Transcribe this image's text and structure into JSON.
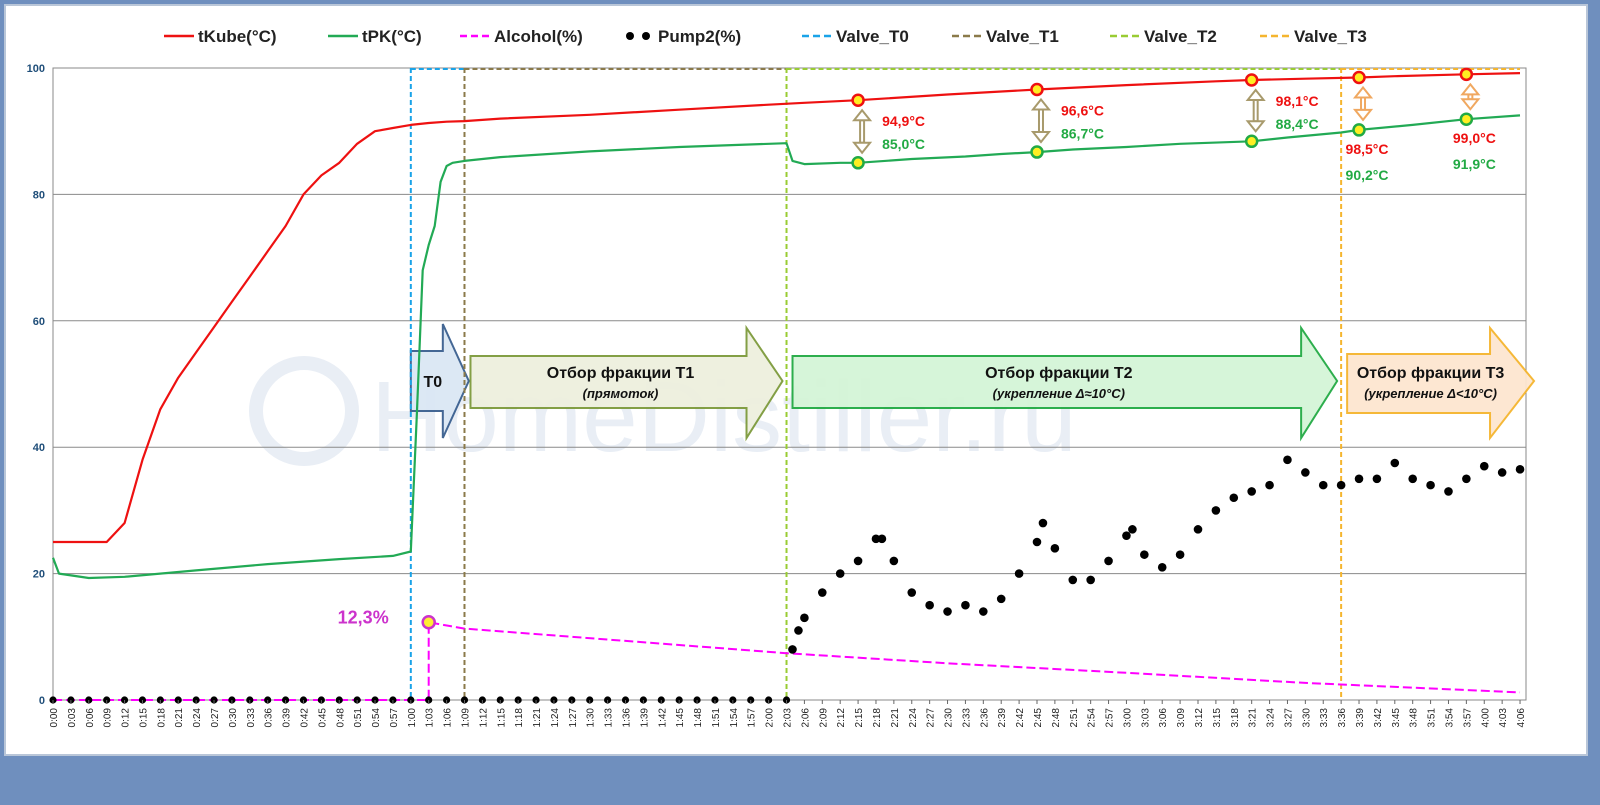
{
  "chart_data": {
    "type": "line",
    "ylim": [
      0,
      100
    ],
    "yticks": [
      0,
      20,
      40,
      60,
      80,
      100
    ],
    "x_start_min": 0,
    "x_end_min": 247,
    "x_tick_step_min": 3,
    "xtick_labels": [
      "0:00",
      "0:03",
      "0:06",
      "0:09",
      "0:12",
      "0:15",
      "0:18",
      "0:21",
      "0:24",
      "0:27",
      "0:30",
      "0:33",
      "0:36",
      "0:39",
      "0:42",
      "0:45",
      "0:48",
      "0:51",
      "0:54",
      "0:57",
      "1:00",
      "1:03",
      "1:06",
      "1:09",
      "1:12",
      "1:15",
      "1:18",
      "1:21",
      "1:24",
      "1:27",
      "1:30",
      "1:33",
      "1:36",
      "1:39",
      "1:42",
      "1:45",
      "1:48",
      "1:51",
      "1:54",
      "1:57",
      "2:00",
      "2:03",
      "2:06",
      "2:09",
      "2:12",
      "2:15",
      "2:18",
      "2:21",
      "2:24",
      "2:27",
      "2:30",
      "2:33",
      "2:36",
      "2:39",
      "2:42",
      "2:45",
      "2:48",
      "2:51",
      "2:54",
      "2:57",
      "3:00",
      "3:03",
      "3:06",
      "3:09",
      "3:12",
      "3:15",
      "3:18",
      "3:21",
      "3:24",
      "3:27",
      "3:30",
      "3:33",
      "3:36",
      "3:39",
      "3:42",
      "3:45",
      "3:48",
      "3:51",
      "3:54",
      "3:57",
      "4:00",
      "4:03",
      "4:06"
    ],
    "series": [
      {
        "name": "tKube(°C)",
        "color": "#ee1111",
        "style": "solid",
        "x": [
          "0:00",
          "0:09",
          "0:12",
          "0:15",
          "0:18",
          "0:21",
          "0:24",
          "0:27",
          "0:30",
          "0:33",
          "0:36",
          "0:39",
          "0:42",
          "0:45",
          "0:48",
          "0:51",
          "0:54",
          "0:57",
          "1:00",
          "1:03",
          "1:06",
          "1:09",
          "1:15",
          "1:30",
          "1:45",
          "2:00",
          "2:06",
          "2:15",
          "2:30",
          "2:45",
          "3:00",
          "3:15",
          "3:21",
          "3:30",
          "3:39",
          "3:45",
          "3:57",
          "4:06"
        ],
        "y": [
          25,
          25,
          28,
          38,
          46,
          51,
          55,
          59,
          63,
          67,
          71,
          75,
          80,
          83,
          85,
          88,
          90,
          90.5,
          91,
          91.3,
          91.5,
          91.6,
          92,
          92.6,
          93.4,
          94.2,
          94.5,
          94.9,
          95.8,
          96.6,
          97.3,
          97.9,
          98.1,
          98.3,
          98.5,
          98.7,
          99.0,
          99.2
        ]
      },
      {
        "name": "tPK(°C)",
        "color": "#22aa55",
        "style": "solid",
        "x": [
          "0:00",
          "0:01",
          "0:06",
          "0:12",
          "0:24",
          "0:36",
          "0:48",
          "0:57",
          "1:00",
          "1:01",
          "1:02",
          "1:03",
          "1:04",
          "1:05",
          "1:06",
          "1:07",
          "1:09",
          "1:15",
          "1:30",
          "1:45",
          "2:03",
          "2:04",
          "2:06",
          "2:12",
          "2:15",
          "2:24",
          "2:33",
          "2:39",
          "2:45",
          "2:51",
          "3:00",
          "3:09",
          "3:21",
          "3:27",
          "3:36",
          "3:39",
          "3:48",
          "3:57",
          "4:06"
        ],
        "y": [
          22.5,
          20,
          19.3,
          19.5,
          20.5,
          21.5,
          22.3,
          22.8,
          23.5,
          45,
          68,
          72,
          75,
          82,
          84.5,
          85,
          85.3,
          85.9,
          86.8,
          87.5,
          88.1,
          85.3,
          84.8,
          85,
          85,
          85.6,
          86,
          86.4,
          86.7,
          87.1,
          87.5,
          88,
          88.4,
          89,
          89.8,
          90.2,
          91,
          91.9,
          92.5
        ]
      },
      {
        "name": "Alcohol(%)",
        "color": "#ff00ff",
        "style": "dashed",
        "x": [
          "0:00",
          "1:02",
          "1:03",
          "1:03",
          "1:09",
          "2:03",
          "2:30",
          "3:00",
          "3:30",
          "4:06"
        ],
        "y": [
          0,
          0,
          0,
          12.3,
          11.3,
          7.4,
          5.8,
          4.3,
          2.7,
          1.2
        ]
      },
      {
        "name": "Pump2(%)",
        "color": "#000000",
        "style": "dotted-markers",
        "x": [
          "0:00",
          "2:03",
          "2:04",
          "2:05",
          "2:06",
          "2:09",
          "2:12",
          "2:15",
          "2:18",
          "2:19",
          "2:21",
          "2:24",
          "2:27",
          "2:30",
          "2:33",
          "2:36",
          "2:39",
          "2:42",
          "2:45",
          "2:46",
          "2:48",
          "2:51",
          "2:54",
          "2:57",
          "3:00",
          "3:01",
          "3:03",
          "3:06",
          "3:09",
          "3:12",
          "3:15",
          "3:18",
          "3:21",
          "3:24",
          "3:27",
          "3:30",
          "3:33",
          "3:36",
          "3:39",
          "3:42",
          "3:45",
          "3:48",
          "3:51",
          "3:54",
          "3:57",
          "4:00",
          "4:03",
          "4:06"
        ],
        "y": [
          0,
          0,
          8,
          11,
          13,
          17,
          20,
          22,
          25.5,
          25.5,
          22,
          17,
          15,
          14,
          15,
          14,
          16,
          20,
          25,
          28,
          24,
          19,
          19,
          22,
          26,
          27,
          23,
          21,
          23,
          27,
          30,
          32,
          33,
          34,
          38,
          36,
          34,
          34,
          35,
          35,
          37.5,
          35,
          34,
          33,
          35,
          37,
          36,
          36.5
        ]
      },
      {
        "name": "Valve_T0",
        "color": "#1aa3e8",
        "style": "dashed",
        "x": [
          "1:00",
          "1:09"
        ],
        "y": [
          100,
          100
        ]
      },
      {
        "name": "Valve_T1",
        "color": "#8b7a4a",
        "style": "dashed",
        "x": [
          "1:09",
          "2:03"
        ],
        "y": [
          100,
          100
        ]
      },
      {
        "name": "Valve_T2",
        "color": "#99cc33",
        "style": "dashed",
        "x": [
          "2:03",
          "3:36"
        ],
        "y": [
          100,
          100
        ]
      },
      {
        "name": "Valve_T3",
        "color": "#f5b52e",
        "style": "dashed",
        "x": [
          "3:36",
          "4:06"
        ],
        "y": [
          100,
          100
        ]
      }
    ],
    "annotations": [
      {
        "x": "2:15",
        "red_label": "94,9°C",
        "green_label": "85,0°C",
        "tkube": 94.9,
        "tpk": 85.0,
        "arrow_color": "#a89a6c",
        "label_side": "right"
      },
      {
        "x": "2:45",
        "red_label": "96,6°C",
        "green_label": "86,7°C",
        "tkube": 96.6,
        "tpk": 86.7,
        "arrow_color": "#a89a6c",
        "label_side": "right"
      },
      {
        "x": "3:21",
        "red_label": "98,1°C",
        "green_label": "88,4°C",
        "tkube": 98.1,
        "tpk": 88.4,
        "arrow_color": "#a89a6c",
        "label_side": "right"
      },
      {
        "x": "3:39",
        "red_label": "98,5°C",
        "green_label": "90,2°C",
        "tkube": 98.5,
        "tpk": 90.2,
        "arrow_color": "#f0a860",
        "label_side": "below"
      },
      {
        "x": "3:57",
        "red_label": "99,0°C",
        "green_label": "91,9°C",
        "tkube": 99.0,
        "tpk": 91.9,
        "arrow_color": "#f0a860",
        "label_side": "below"
      }
    ],
    "alcohol_peak": {
      "x": "1:03",
      "y": 12.3,
      "label": "12,3%"
    },
    "phases": [
      {
        "label": "T0",
        "sub": "",
        "x_from": "1:00",
        "x_to": "1:09",
        "fill": "#dbe7f4",
        "stroke": "#3a5f8f"
      },
      {
        "label": "Отбор фракции Т1",
        "sub": "(прямоток)",
        "x_from": "1:09",
        "x_to": "2:03",
        "fill": "#eef0de",
        "stroke": "#7d9a3c"
      },
      {
        "label": "Отбор фракции Т2",
        "sub": "(укрепление  Δ≈10°С)",
        "x_from": "2:03",
        "x_to": "3:36",
        "fill": "#d4f5d7",
        "stroke": "#22aa44"
      },
      {
        "label": "Отбор фракции Т3",
        "sub": "(укрепление  Δ<10°С)",
        "x_from": "3:36",
        "x_to": "4:06",
        "fill": "#fde6d0",
        "stroke": "#f5b52e"
      }
    ],
    "watermark": "HomeDistiller.ru",
    "legend_position": "top"
  }
}
